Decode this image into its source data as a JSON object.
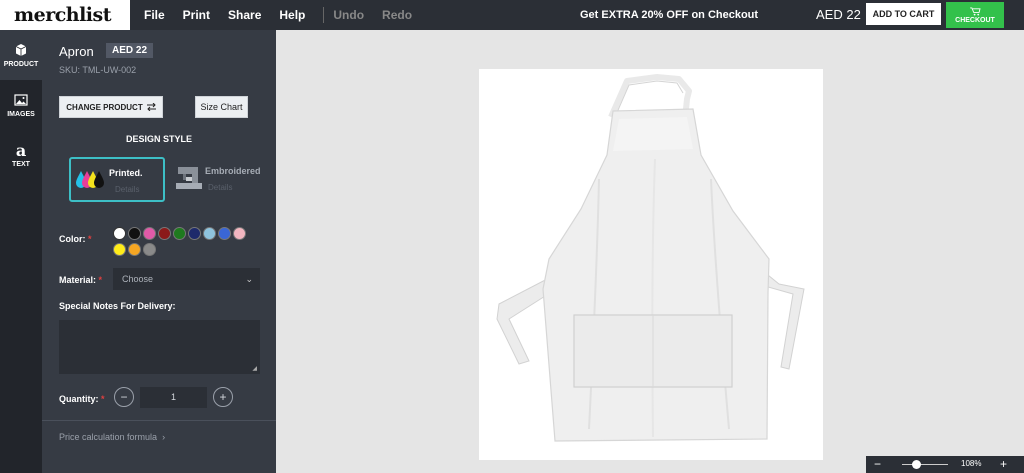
{
  "brand": {
    "logo": "merchlist"
  },
  "menu": {
    "file": "File",
    "print": "Print",
    "share": "Share",
    "help": "Help",
    "undo": "Undo",
    "redo": "Redo"
  },
  "promo": "Get EXTRA 20% OFF on Checkout",
  "cart": {
    "price": "AED 22",
    "add_to_cart": "ADD TO CART",
    "checkout": "CHECKOUT"
  },
  "rail": {
    "product": "PRODUCT",
    "images": "IMAGES",
    "text": "TEXT"
  },
  "product": {
    "name": "Apron",
    "price_badge": "AED 22",
    "sku": "SKU: TML-UW-002"
  },
  "buttons": {
    "change_product": "CHANGE PRODUCT",
    "size_chart": "Size Chart"
  },
  "design_style": {
    "title": "DESIGN STYLE",
    "printed": {
      "label": "Printed.",
      "sub": "Details"
    },
    "embroidered": {
      "label": "Embroidered",
      "sub": "Details"
    }
  },
  "color": {
    "label": "Color:",
    "required_mark": "*",
    "swatches": [
      "#ffffff",
      "#111111",
      "#e05aa8",
      "#8b1a1a",
      "#1f7a1f",
      "#1e2a6b",
      "#8fc4de",
      "#3a66d6",
      "#f2b6c0",
      "#ffec1a",
      "#f5a623",
      "#8a8a8a"
    ]
  },
  "material": {
    "label": "Material:",
    "required_mark": "*",
    "value": "Choose"
  },
  "notes": {
    "label": "Special Notes For Delivery:"
  },
  "quantity": {
    "label": "Quantity:",
    "required_mark": "*",
    "minus": "−",
    "value": "1",
    "plus": "+"
  },
  "price_formula": "Price calculation formula",
  "zoom": {
    "minus": "−",
    "level": "108%",
    "plus": "+"
  }
}
